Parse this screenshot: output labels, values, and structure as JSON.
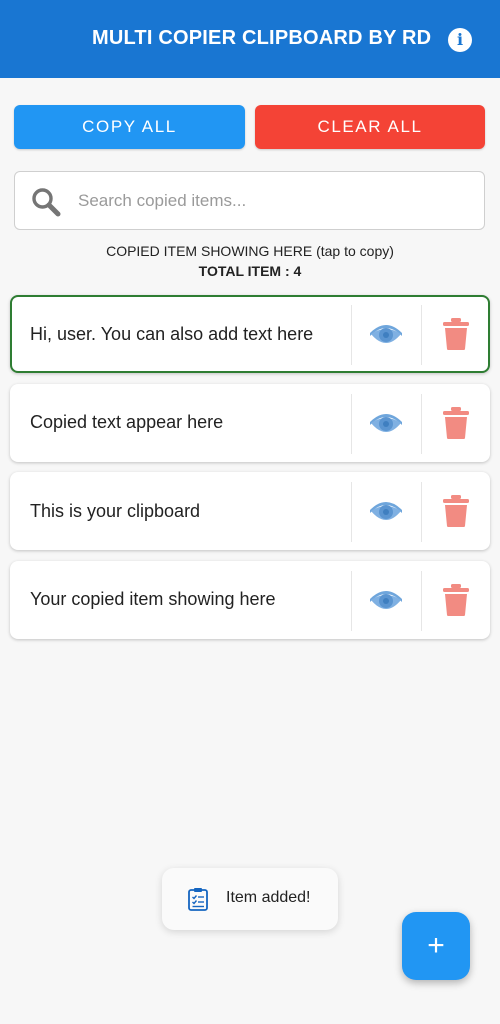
{
  "app": {
    "title": "MULTI COPIER CLIPBOARD BY RD",
    "info_icon": "info-icon",
    "info_glyph": "i",
    "primary_color": "#1976d2"
  },
  "actions": {
    "copy_all_label": "COPY ALL",
    "clear_all_label": "CLEAR ALL",
    "copy_color": "#2196f3",
    "clear_color": "#f44336"
  },
  "search": {
    "placeholder": "Search copied items...",
    "value": "",
    "icon": "search-icon"
  },
  "status": {
    "hint": "COPIED ITEM SHOWING HERE (tap to copy)",
    "total": "TOTAL ITEM : 4"
  },
  "items": [
    {
      "text": "Hi, user. You can also add text here",
      "selected": true
    },
    {
      "text": "Copied text appear here",
      "selected": false
    },
    {
      "text": "This is your clipboard",
      "selected": false
    },
    {
      "text": "Your copied item showing here",
      "selected": false
    }
  ],
  "item_actions": {
    "view_icon": "eye-icon",
    "delete_icon": "trash-icon"
  },
  "toast": {
    "text": "Item added!",
    "icon": "clipboard-icon"
  },
  "fab": {
    "glyph": "+",
    "icon": "plus-icon"
  }
}
